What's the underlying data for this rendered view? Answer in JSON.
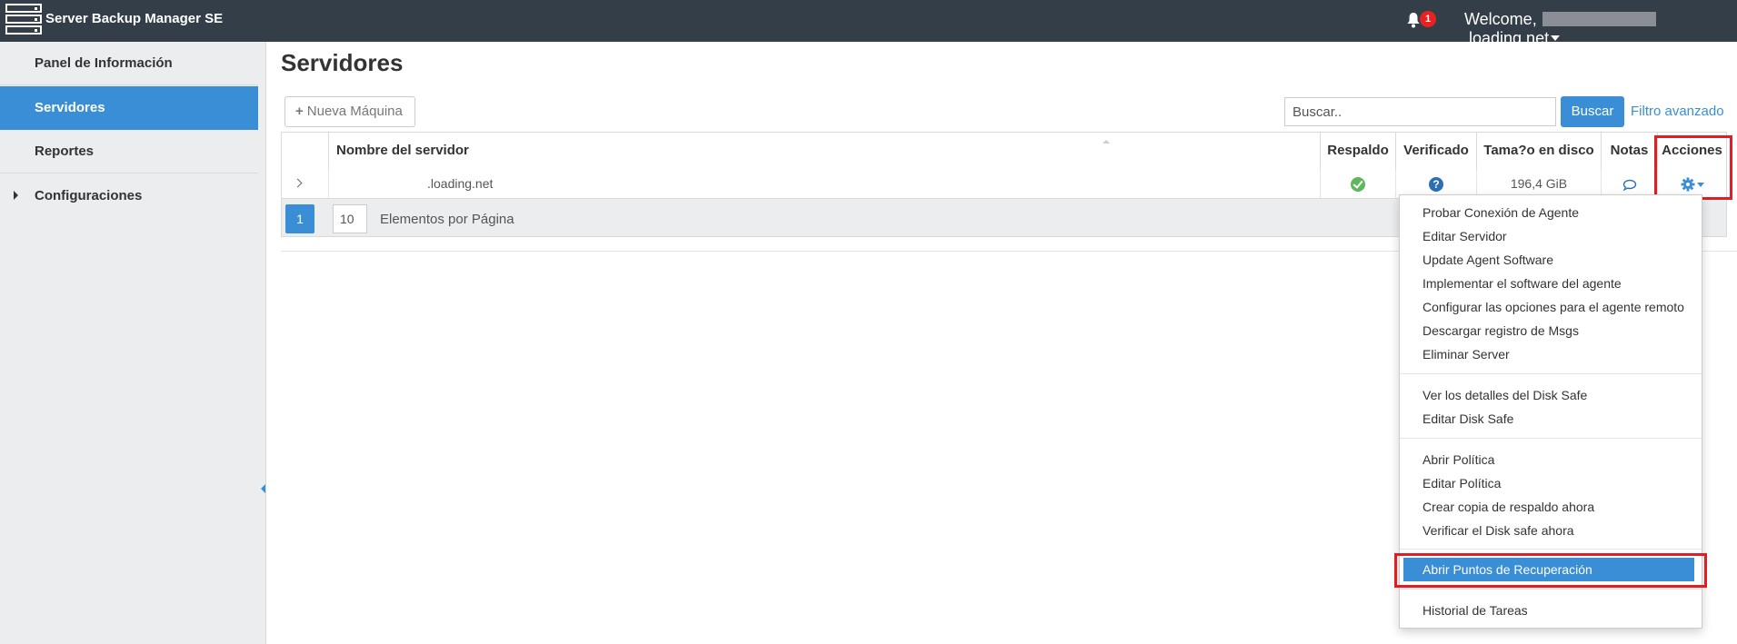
{
  "app": {
    "title": "Server Backup Manager SE",
    "notifications_count": "1"
  },
  "user": {
    "welcome_prefix": "Welcome,",
    "domain_suffix": ".loading.net"
  },
  "sidebar": {
    "items": [
      {
        "label": "Panel de Información"
      },
      {
        "label": "Servidores"
      },
      {
        "label": "Reportes"
      },
      {
        "label": "Configuraciones"
      }
    ]
  },
  "page": {
    "title": "Servidores",
    "new_machine_label": "Nueva Máquina",
    "search_placeholder": "Buscar..",
    "search_button": "Buscar",
    "advanced_filter": "Filtro avanzado"
  },
  "table": {
    "columns": [
      "Nombre del servidor",
      "Respaldo",
      "Verificado",
      "Tama?o en disco",
      "Notas",
      "Acciones"
    ],
    "rows": [
      {
        "server_name": ".loading.net",
        "backup_status": "ok",
        "verified_status": "unknown",
        "disk_size": "196,4 GiB"
      }
    ],
    "pager": {
      "current_page": "1",
      "page_size": "10",
      "page_size_label": "Elementos por Página"
    }
  },
  "actions_menu": {
    "groups": [
      [
        "Probar Conexión de Agente",
        "Editar Servidor",
        "Update Agent Software",
        "Implementar el software del agente",
        "Configurar las opciones para el agente remoto",
        "Descargar registro de Msgs",
        "Eliminar Server"
      ],
      [
        "Ver los detalles del Disk Safe",
        "Editar Disk Safe"
      ],
      [
        "Abrir Política",
        "Editar Política",
        "Crear copia de respaldo ahora",
        "Verificar el Disk safe ahora"
      ],
      [
        "Abrir Puntos de Recuperación"
      ],
      [
        "Historial de Tareas"
      ]
    ],
    "selected_item": "Abrir Puntos de Recuperación"
  },
  "colors": {
    "header_bg": "#343e48",
    "accent": "#3a8ed6",
    "highlight_box": "#e21d24"
  }
}
